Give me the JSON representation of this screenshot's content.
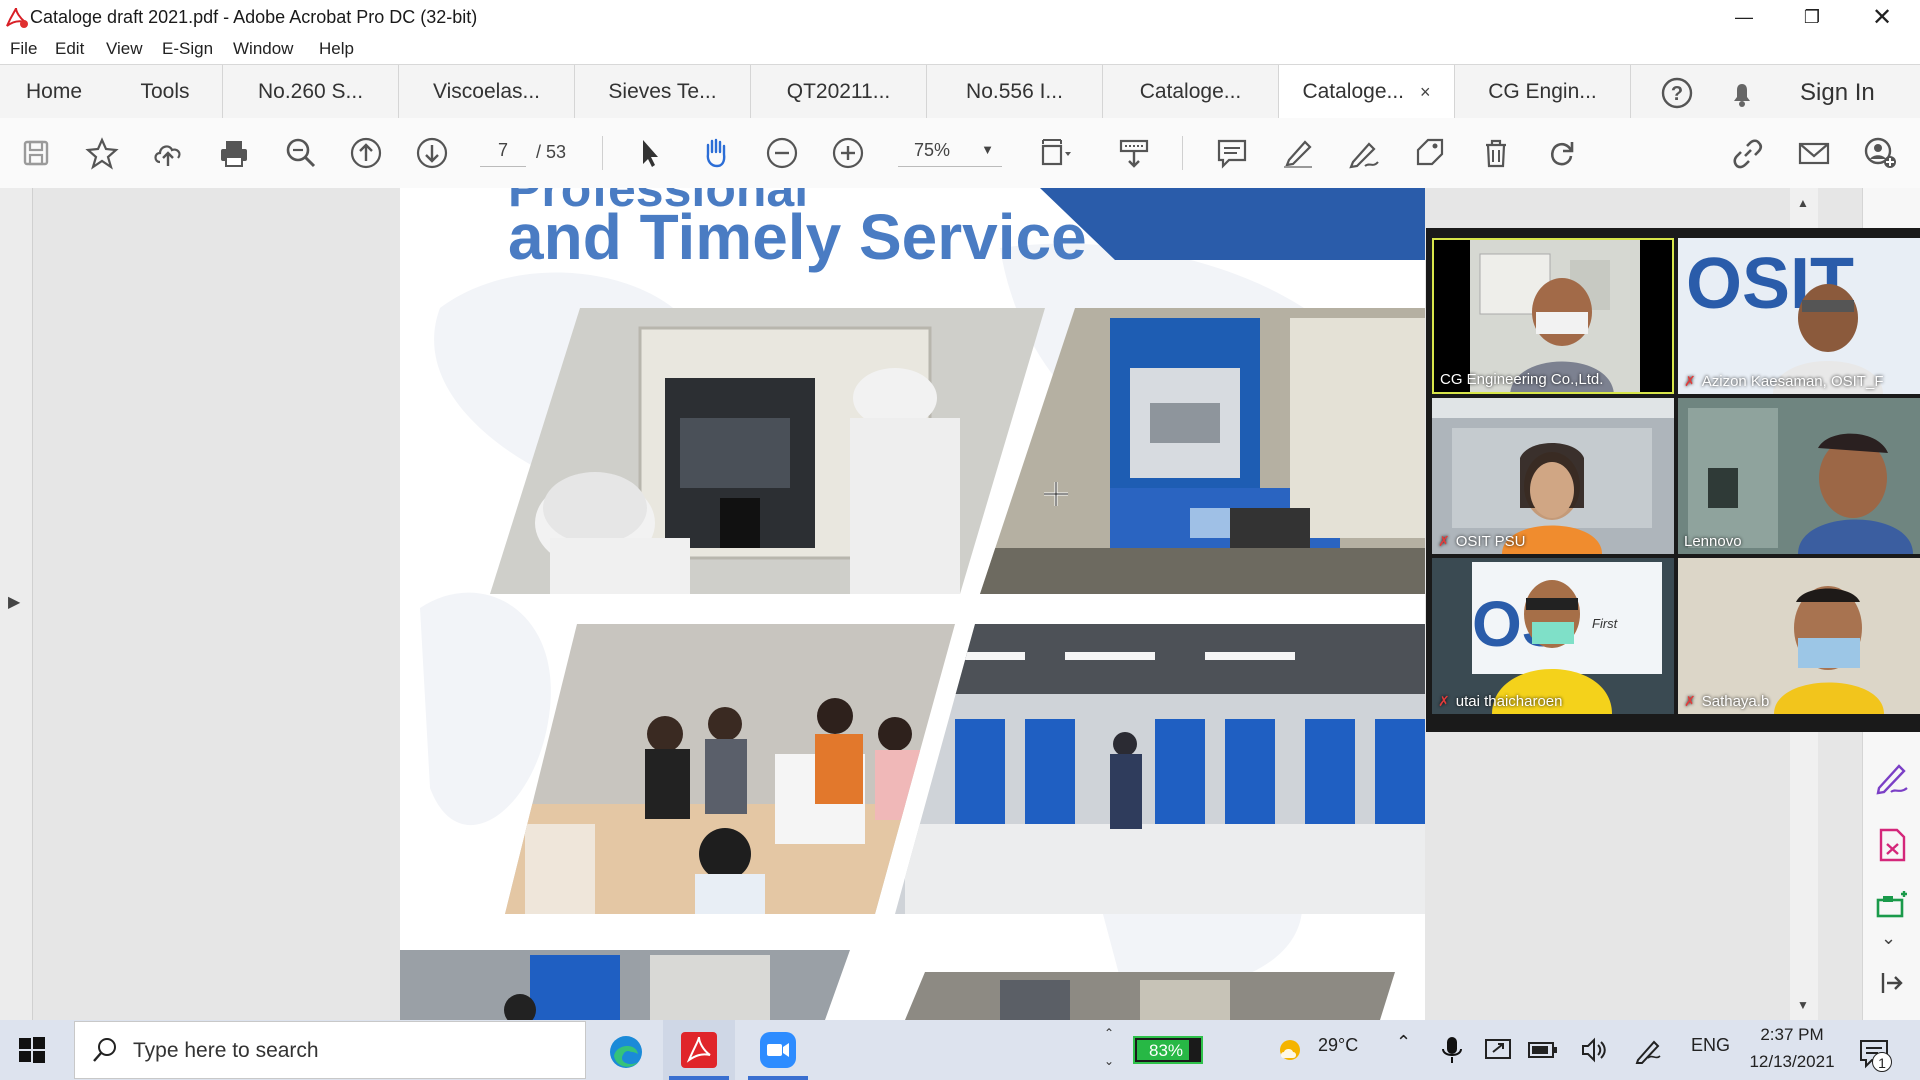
{
  "window": {
    "title": "Cataloge draft 2021.pdf - Adobe Acrobat Pro DC (32-bit)",
    "controls": [
      "minimize",
      "restore",
      "close"
    ]
  },
  "menu": [
    "File",
    "Edit",
    "View",
    "E-Sign",
    "Window",
    "Help"
  ],
  "tabs": {
    "home": "Home",
    "tools": "Tools",
    "documents": [
      "No.260 S...",
      "Viscoelas...",
      "Sieves Te...",
      "QT20211...",
      "No.556 I...",
      "Cataloge...",
      "Cataloge...",
      "CG Engin..."
    ],
    "active_index": 6,
    "close_glyph": "×",
    "sign_in": "Sign In"
  },
  "toolbar": {
    "page_current": "7",
    "page_total": "/ 53",
    "zoom": "75%"
  },
  "page": {
    "heading": "and Timely Service",
    "heading_partial": "Professional",
    "accent_color": "#2a5caa",
    "heading_color": "#4a7cc3"
  },
  "video_call": {
    "participants": [
      {
        "name": "CG Engineering Co.,Ltd.",
        "muted": false,
        "active_speaker": true
      },
      {
        "name": "Azizon Kaesaman, OSIT_F",
        "muted": true
      },
      {
        "name": "OSIT PSU",
        "muted": true
      },
      {
        "name": "Lennovo",
        "muted": false
      },
      {
        "name": "utai thaicharoen",
        "muted": true
      },
      {
        "name": "Sathaya.b",
        "muted": true
      }
    ],
    "logo_text": "OSIT",
    "logo_tag": "since 1993 First"
  },
  "taskbar": {
    "search_placeholder": "Type here to search",
    "battery": "83%",
    "weather": "29°C",
    "language": "ENG",
    "time": "2:37 PM",
    "date": "12/13/2021",
    "notification_count": "1"
  }
}
